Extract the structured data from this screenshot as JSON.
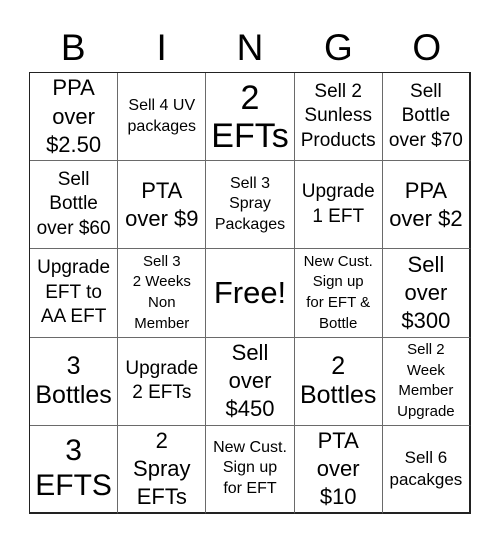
{
  "header": {
    "letters": [
      "B",
      "I",
      "N",
      "G",
      "O"
    ]
  },
  "cells": [
    "PPA\nover\n$2.50",
    "Sell 4 UV\npackages",
    "2\nEFTs",
    "Sell 2\nSunless\nProducts",
    "Sell\nBottle\nover $70",
    "Sell\nBottle\nover $60",
    "PTA\nover $9",
    "Sell 3\nSpray\nPackages",
    "Upgrade\n1 EFT",
    "PPA\nover $2",
    "Upgrade\nEFT to\nAA EFT",
    "Sell 3\n2 Weeks\nNon\nMember",
    "Free!",
    "New Cust.\nSign up\nfor EFT &\nBottle",
    "Sell\nover\n$300",
    "3\nBottles",
    "Upgrade\n2 EFTs",
    "Sell\nover\n$450",
    "2\nBottles",
    "Sell 2\nWeek\nMember\nUpgrade",
    "3\nEFTS",
    "2\nSpray\nEFTs",
    "New Cust.\nSign up\nfor EFT",
    "PTA\nover\n$10",
    "Sell 6\npacakges"
  ]
}
